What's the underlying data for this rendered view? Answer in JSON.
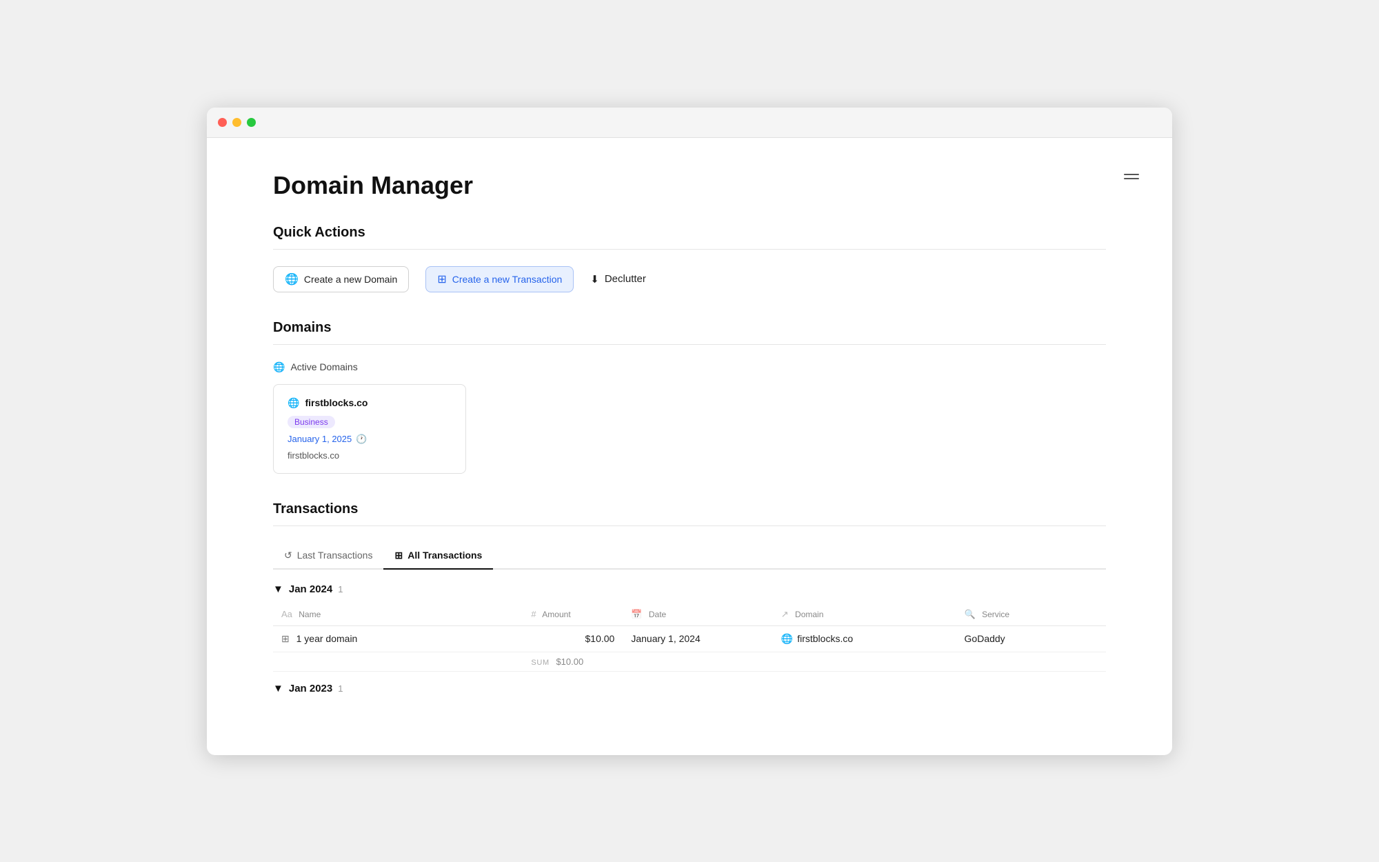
{
  "window": {
    "title": "Domain Manager"
  },
  "pageTitle": "Domain Manager",
  "sections": {
    "quickActions": {
      "title": "Quick Actions",
      "buttons": [
        {
          "id": "create-domain",
          "label": "Create a new Domain",
          "style": "outline"
        },
        {
          "id": "create-transaction",
          "label": "Create a new Transaction",
          "style": "blue"
        },
        {
          "id": "declutter",
          "label": "Declutter",
          "style": "plain"
        }
      ]
    },
    "domains": {
      "title": "Domains",
      "subsection": "Active Domains",
      "cards": [
        {
          "name": "firstblocks.co",
          "badge": "Business",
          "date": "January 1, 2025",
          "url": "firstblocks.co"
        }
      ]
    },
    "transactions": {
      "title": "Transactions",
      "tabs": [
        {
          "id": "last",
          "label": "Last Transactions"
        },
        {
          "id": "all",
          "label": "All Transactions",
          "active": true
        }
      ],
      "groups": [
        {
          "period": "Jan 2024",
          "count": 1,
          "columns": [
            {
              "id": "name",
              "label": "Name",
              "icon": "Aa"
            },
            {
              "id": "amount",
              "label": "Amount",
              "icon": "#"
            },
            {
              "id": "date",
              "label": "Date",
              "icon": "📅"
            },
            {
              "id": "domain",
              "label": "Domain",
              "icon": "↗"
            },
            {
              "id": "service",
              "label": "Service",
              "icon": "🔍"
            }
          ],
          "rows": [
            {
              "name": "1 year domain",
              "amount": "$10.00",
              "date": "January 1, 2024",
              "domain": "firstblocks.co",
              "service": "GoDaddy"
            }
          ],
          "sum": "$10.00"
        },
        {
          "period": "Jan 2023",
          "count": 1,
          "columns": [],
          "rows": [],
          "sum": ""
        }
      ]
    }
  }
}
